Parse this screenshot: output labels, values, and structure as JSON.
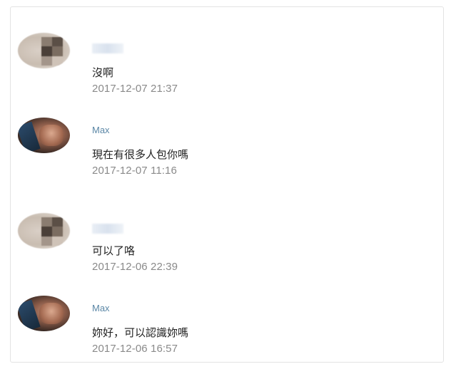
{
  "messages": [
    {
      "sender": "",
      "avatar": "blurred-avatar",
      "text": "沒啊",
      "time": "2017-12-07 21:37"
    },
    {
      "sender": "Max",
      "avatar": "photo-avatar",
      "text": "現在有很多人包你嗎",
      "time": "2017-12-07 11:16"
    },
    {
      "sender": "",
      "avatar": "blurred-avatar",
      "text": "可以了咯",
      "time": "2017-12-06 22:39"
    },
    {
      "sender": "Max",
      "avatar": "photo-avatar",
      "text": "妳好，可以認識妳嗎",
      "time": "2017-12-06 16:57"
    }
  ]
}
